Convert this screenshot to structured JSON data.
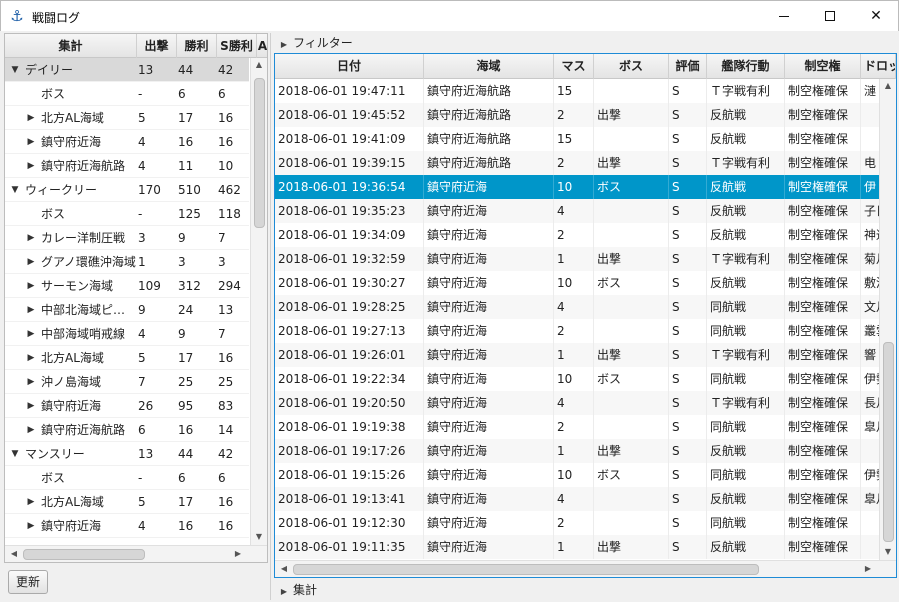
{
  "window": {
    "title": "戦闘ログ",
    "icon": "anchor-icon"
  },
  "left": {
    "columns": [
      "集計",
      "出撃",
      "勝利",
      "S勝利",
      "A"
    ],
    "rows": [
      {
        "indent": 0,
        "expand": "down",
        "name": "デイリー",
        "v1": "13",
        "v2": "44",
        "v3": "42",
        "selected": true
      },
      {
        "indent": 1,
        "expand": "",
        "name": "ボス",
        "v1": "-",
        "v2": "6",
        "v3": "6"
      },
      {
        "indent": 1,
        "expand": "right",
        "name": "北方AL海域",
        "v1": "5",
        "v2": "17",
        "v3": "16"
      },
      {
        "indent": 1,
        "expand": "right",
        "name": "鎮守府近海",
        "v1": "4",
        "v2": "16",
        "v3": "16"
      },
      {
        "indent": 1,
        "expand": "right",
        "name": "鎮守府近海航路",
        "v1": "4",
        "v2": "11",
        "v3": "10"
      },
      {
        "indent": 0,
        "expand": "down",
        "name": "ウィークリー",
        "v1": "170",
        "v2": "510",
        "v3": "462"
      },
      {
        "indent": 1,
        "expand": "",
        "name": "ボス",
        "v1": "-",
        "v2": "125",
        "v3": "118"
      },
      {
        "indent": 1,
        "expand": "right",
        "name": "カレー洋制圧戦",
        "v1": "3",
        "v2": "9",
        "v3": "7"
      },
      {
        "indent": 1,
        "expand": "right",
        "name": "グアノ環礁沖海域",
        "v1": "1",
        "v2": "3",
        "v3": "3"
      },
      {
        "indent": 1,
        "expand": "right",
        "name": "サーモン海域",
        "v1": "109",
        "v2": "312",
        "v3": "294"
      },
      {
        "indent": 1,
        "expand": "right",
        "name": "中部北海域ピ…",
        "v1": "9",
        "v2": "24",
        "v3": "13"
      },
      {
        "indent": 1,
        "expand": "right",
        "name": "中部海域哨戒線",
        "v1": "4",
        "v2": "9",
        "v3": "7"
      },
      {
        "indent": 1,
        "expand": "right",
        "name": "北方AL海域",
        "v1": "5",
        "v2": "17",
        "v3": "16"
      },
      {
        "indent": 1,
        "expand": "right",
        "name": "沖ノ島海域",
        "v1": "7",
        "v2": "25",
        "v3": "25"
      },
      {
        "indent": 1,
        "expand": "right",
        "name": "鎮守府近海",
        "v1": "26",
        "v2": "95",
        "v3": "83"
      },
      {
        "indent": 1,
        "expand": "right",
        "name": "鎮守府近海航路",
        "v1": "6",
        "v2": "16",
        "v3": "14"
      },
      {
        "indent": 0,
        "expand": "down",
        "name": "マンスリー",
        "v1": "13",
        "v2": "44",
        "v3": "42"
      },
      {
        "indent": 1,
        "expand": "",
        "name": "ボス",
        "v1": "-",
        "v2": "6",
        "v3": "6"
      },
      {
        "indent": 1,
        "expand": "right",
        "name": "北方AL海域",
        "v1": "5",
        "v2": "17",
        "v3": "16"
      },
      {
        "indent": 1,
        "expand": "right",
        "name": "鎮守府近海",
        "v1": "4",
        "v2": "16",
        "v3": "16"
      }
    ],
    "refresh_label": "更新"
  },
  "filter_label": "フィルター",
  "summary_label": "集計",
  "table": {
    "columns": [
      "日付",
      "海域",
      "マス",
      "ボス",
      "評価",
      "艦隊行動",
      "制空権",
      "ドロップ"
    ],
    "rows": [
      [
        "2018-06-01 19:47:11",
        "鎮守府近海航路",
        "15",
        "",
        "S",
        "Ｔ字戦有利",
        "制空権確保",
        "漣"
      ],
      [
        "2018-06-01 19:45:52",
        "鎮守府近海航路",
        "2",
        "出撃",
        "S",
        "反航戦",
        "制空権確保",
        ""
      ],
      [
        "2018-06-01 19:41:09",
        "鎮守府近海航路",
        "15",
        "",
        "S",
        "反航戦",
        "制空権確保",
        ""
      ],
      [
        "2018-06-01 19:39:15",
        "鎮守府近海航路",
        "2",
        "出撃",
        "S",
        "Ｔ字戦有利",
        "制空権確保",
        "电"
      ],
      [
        "2018-06-01 19:36:54",
        "鎮守府近海",
        "10",
        "ボス",
        "S",
        "反航戦",
        "制空権確保",
        "伊"
      ],
      [
        "2018-06-01 19:35:23",
        "鎮守府近海",
        "4",
        "",
        "S",
        "反航戦",
        "制空権確保",
        "子日"
      ],
      [
        "2018-06-01 19:34:09",
        "鎮守府近海",
        "2",
        "",
        "S",
        "反航戦",
        "制空権確保",
        "神通"
      ],
      [
        "2018-06-01 19:32:59",
        "鎮守府近海",
        "1",
        "出撃",
        "S",
        "Ｔ字戦有利",
        "制空権確保",
        "菊月"
      ],
      [
        "2018-06-01 19:30:27",
        "鎮守府近海",
        "10",
        "ボス",
        "S",
        "反航戦",
        "制空権確保",
        "敷波"
      ],
      [
        "2018-06-01 19:28:25",
        "鎮守府近海",
        "4",
        "",
        "S",
        "同航戦",
        "制空権確保",
        "文月"
      ],
      [
        "2018-06-01 19:27:13",
        "鎮守府近海",
        "2",
        "",
        "S",
        "同航戦",
        "制空権確保",
        "叢雲"
      ],
      [
        "2018-06-01 19:26:01",
        "鎮守府近海",
        "1",
        "出撃",
        "S",
        "Ｔ字戦有利",
        "制空権確保",
        "響"
      ],
      [
        "2018-06-01 19:22:34",
        "鎮守府近海",
        "10",
        "ボス",
        "S",
        "同航戦",
        "制空権確保",
        "伊勢"
      ],
      [
        "2018-06-01 19:20:50",
        "鎮守府近海",
        "4",
        "",
        "S",
        "Ｔ字戦有利",
        "制空権確保",
        "長月"
      ],
      [
        "2018-06-01 19:19:38",
        "鎮守府近海",
        "2",
        "",
        "S",
        "同航戦",
        "制空権確保",
        "皐月"
      ],
      [
        "2018-06-01 19:17:26",
        "鎮守府近海",
        "1",
        "出撃",
        "S",
        "反航戦",
        "制空権確保",
        ""
      ],
      [
        "2018-06-01 19:15:26",
        "鎮守府近海",
        "10",
        "ボス",
        "S",
        "同航戦",
        "制空権確保",
        "伊勢"
      ],
      [
        "2018-06-01 19:13:41",
        "鎮守府近海",
        "4",
        "",
        "S",
        "反航戦",
        "制空権確保",
        "皐月"
      ],
      [
        "2018-06-01 19:12:30",
        "鎮守府近海",
        "2",
        "",
        "S",
        "同航戦",
        "制空権確保",
        ""
      ],
      [
        "2018-06-01 19:11:35",
        "鎮守府近海",
        "1",
        "出撃",
        "S",
        "反航戦",
        "制空権確保",
        ""
      ]
    ],
    "selected_index": 4
  }
}
